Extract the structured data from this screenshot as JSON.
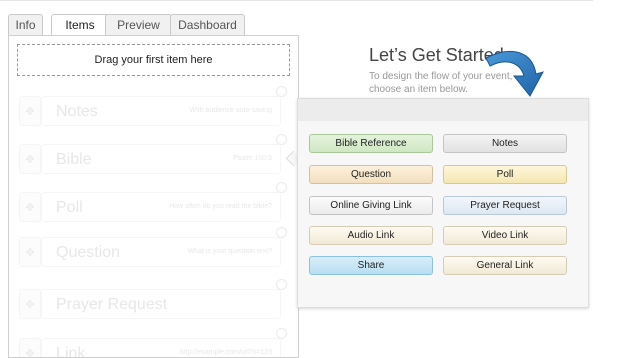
{
  "tabs": [
    {
      "label": "Info"
    },
    {
      "label": "Items"
    },
    {
      "label": "Preview"
    },
    {
      "label": "Dashboard"
    }
  ],
  "active_tab": "Items",
  "dropzone": {
    "label": "Drag your first item here"
  },
  "ghost_items": [
    {
      "title": "Notes",
      "subtitle": "With audience auto-saving"
    },
    {
      "title": "Bible",
      "subtitle": "Psalm 100:5"
    },
    {
      "title": "Poll",
      "subtitle": "How often do you read the bible?"
    },
    {
      "title": "Question",
      "subtitle": "What is your question text?"
    },
    {
      "title": "Prayer Request",
      "subtitle": ""
    },
    {
      "title": "Link",
      "subtitle": "http://example.com/url?x=123"
    }
  ],
  "getting_started": {
    "headline": "Let’s Get Started",
    "intro": "To design the flow of your event, choose an item below."
  },
  "item_buttons": [
    {
      "label": "Bible Reference",
      "color": "#d7edcd"
    },
    {
      "label": "Notes",
      "color": "#e6e6e6"
    },
    {
      "label": "Question",
      "color": "#f6e6c8"
    },
    {
      "label": "Poll",
      "color": "#f8edc2"
    },
    {
      "label": "Online Giving Link",
      "color": "#f1f1f1"
    },
    {
      "label": "Prayer Request",
      "color": "#e5eef6"
    },
    {
      "label": "Audio Link",
      "color": "#f6f0e1"
    },
    {
      "label": "Video Link",
      "color": "#f6f0e1"
    },
    {
      "label": "Share",
      "color": "#c6e5f5"
    },
    {
      "label": "General Link",
      "color": "#f6f0e1"
    }
  ],
  "accent_color": "#2a78c0"
}
